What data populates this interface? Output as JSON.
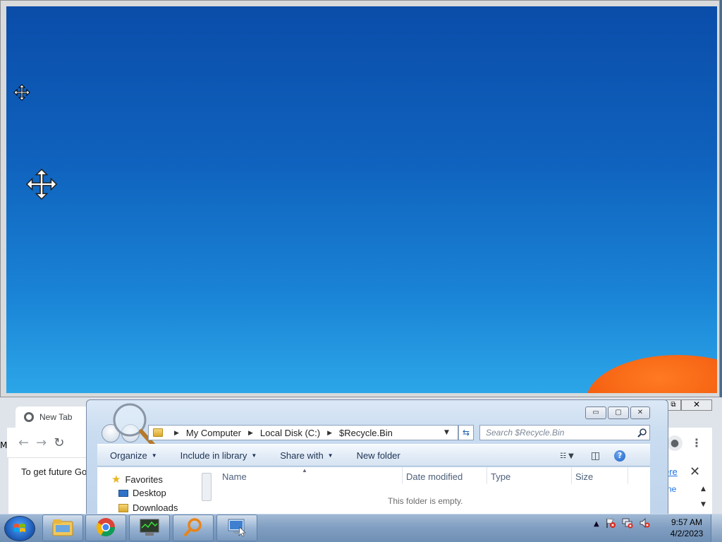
{
  "chrome": {
    "tab_title": "New Tab",
    "notice_text": "To get future Go",
    "notice_link_partial": "ere",
    "right_text_partial": "ne",
    "left_edge_letter": "M",
    "restore_glyph": "⧉",
    "close_glyph": "✕",
    "back_glyph": "←",
    "forward_glyph": "→",
    "reload_glyph": "↻",
    "menu_glyph": "⋮",
    "scroll_up_glyph": "▲",
    "scroll_down_glyph": "▼"
  },
  "explorer": {
    "breadcrumb": [
      "My Computer",
      "Local Disk (C:)",
      "$Recycle.Bin"
    ],
    "search_placeholder": "Search $Recycle.Bin",
    "toolbar": {
      "organize": "Organize",
      "include_in_library": "Include in library",
      "share_with": "Share with",
      "new_folder": "New folder"
    },
    "nav_pane": {
      "favorites": "Favorites",
      "desktop": "Desktop",
      "downloads": "Downloads"
    },
    "columns": [
      "Name",
      "Date modified",
      "Type",
      "Size"
    ],
    "empty_message": "This folder is empty.",
    "help_glyph": "?",
    "window_buttons": {
      "minimize": "▭",
      "maximize": "▢",
      "close": "✕"
    }
  },
  "taskbar": {
    "time": "9:57 AM",
    "date": "4/2/2023",
    "tray_caret": "▲",
    "apps": [
      "file-explorer",
      "google-chrome",
      "task-manager",
      "magnifier",
      "remote-desktop"
    ]
  },
  "colors": {
    "desktop_top": "#0a4da9",
    "desktop_bottom": "#2ca6e8",
    "accent_orange": "#f25a0c",
    "taskbar": "#7f9dc0"
  }
}
